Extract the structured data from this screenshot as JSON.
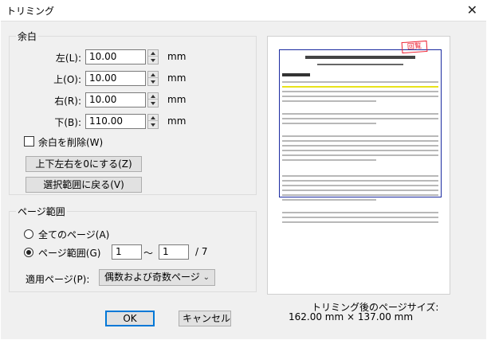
{
  "window": {
    "title": "トリミング"
  },
  "margins": {
    "group_title": "余白",
    "rows": [
      {
        "label": "左(L):",
        "value": "10.00",
        "unit": "mm"
      },
      {
        "label": "上(O):",
        "value": "10.00",
        "unit": "mm"
      },
      {
        "label": "右(R):",
        "value": "10.00",
        "unit": "mm"
      },
      {
        "label": "下(B):",
        "value": "110.00",
        "unit": "mm"
      }
    ],
    "remove_margin_label": "余白を削除(W)",
    "remove_margin_checked": false,
    "zero_button": "上下左右を0にする(Z)",
    "back_button": "選択範囲に戻る(V)"
  },
  "page_range": {
    "group_title": "ページ範囲",
    "all_pages_label": "全てのページ(A)",
    "range_label": "ページ範囲(G)",
    "selected": "range",
    "from": "1",
    "to": "1",
    "separator": "〜",
    "total": "/ 7",
    "apply_label": "適用ページ(P):",
    "apply_value": "偶数および奇数ページ"
  },
  "buttons": {
    "ok": "OK",
    "cancel": "キャンセル"
  },
  "preview": {
    "stamp": "回覧",
    "size_caption": "トリミング後のページサイズ:",
    "size_value": "162.00 mm × 137.00 mm"
  }
}
